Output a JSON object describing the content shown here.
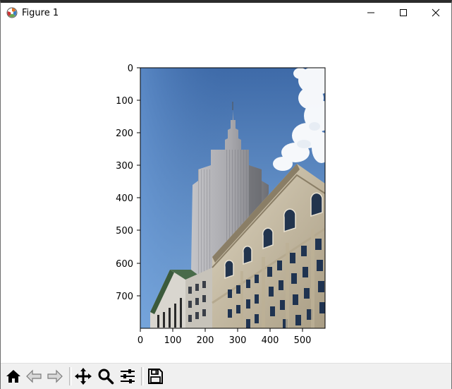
{
  "window": {
    "title": "Figure 1"
  },
  "titlebar_buttons": {
    "minimize_icon": "minimize-icon",
    "maximize_icon": "maximize-icon",
    "close_icon": "close-icon"
  },
  "plot": {
    "image_description_icon": "photo-image",
    "x_ticks": [
      "0",
      "100",
      "200",
      "300",
      "400",
      "500"
    ],
    "y_ticks": [
      "0",
      "100",
      "200",
      "300",
      "400",
      "500",
      "600",
      "700"
    ]
  },
  "toolbar": {
    "buttons": [
      {
        "name": "home",
        "icon": "home-icon"
      },
      {
        "name": "back",
        "icon": "back-arrow-icon"
      },
      {
        "name": "forward",
        "icon": "forward-arrow-icon"
      },
      {
        "name": "pan",
        "icon": "move-icon"
      },
      {
        "name": "zoom",
        "icon": "magnifier-icon"
      },
      {
        "name": "configure-subplots",
        "icon": "sliders-icon"
      },
      {
        "name": "save",
        "icon": "floppy-disk-icon"
      }
    ]
  },
  "colors": {
    "sky_top": "#3f6fae",
    "sky_bottom": "#8bb6e6",
    "building": "#9a9a9a",
    "facade": "#cfc6b0",
    "window": "#2c4a6e"
  }
}
